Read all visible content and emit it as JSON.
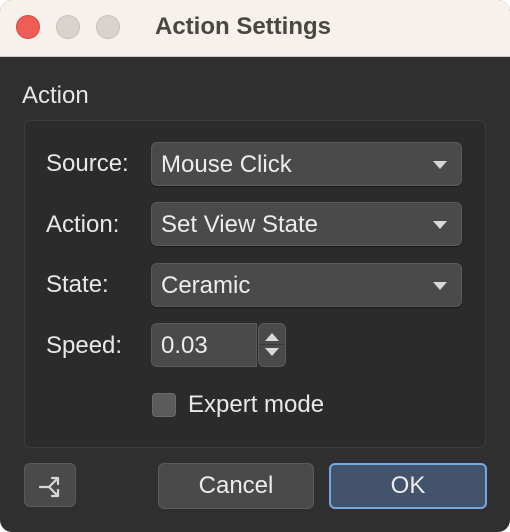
{
  "window": {
    "title": "Action Settings"
  },
  "group": {
    "label": "Action"
  },
  "fields": {
    "source": {
      "label": "Source:",
      "value": "Mouse Click"
    },
    "action": {
      "label": "Action:",
      "value": "Set View State"
    },
    "state": {
      "label": "State:",
      "value": "Ceramic"
    },
    "speed": {
      "label": "Speed:",
      "value": "0.03"
    }
  },
  "expert_mode": {
    "label": "Expert mode",
    "checked": false
  },
  "buttons": {
    "cancel": "Cancel",
    "ok": "OK"
  },
  "icons": {
    "close": "close-traffic-light",
    "minimize": "minimize-traffic-light",
    "maximize": "maximize-traffic-light",
    "tool": "branch-icon"
  },
  "colors": {
    "accent": "#7aa8e6",
    "close_red": "#ee5e57"
  }
}
